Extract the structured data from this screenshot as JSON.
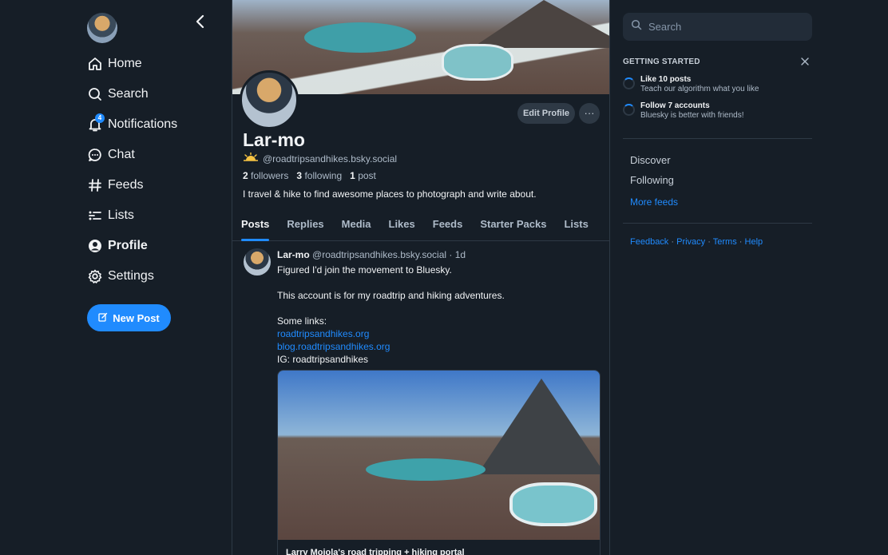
{
  "nav": {
    "items": [
      {
        "label": "Home",
        "icon": "home-icon"
      },
      {
        "label": "Search",
        "icon": "search-icon"
      },
      {
        "label": "Notifications",
        "icon": "bell-icon",
        "badge": "4"
      },
      {
        "label": "Chat",
        "icon": "chat-icon"
      },
      {
        "label": "Feeds",
        "icon": "hash-icon"
      },
      {
        "label": "Lists",
        "icon": "list-icon"
      },
      {
        "label": "Profile",
        "icon": "user-circle-icon",
        "active": true
      },
      {
        "label": "Settings",
        "icon": "gear-icon"
      }
    ],
    "new_post_label": "New Post"
  },
  "profile": {
    "display_name": "Lar-mo",
    "handle": "@roadtripsandhikes.bsky.social",
    "followers_count": "2",
    "followers_label": "followers",
    "following_count": "3",
    "following_label": "following",
    "posts_count": "1",
    "posts_label": "post",
    "bio": "I travel & hike to find awesome places to photograph and write about.",
    "edit_label": "Edit Profile",
    "more_label": "···"
  },
  "tabs": [
    "Posts",
    "Replies",
    "Media",
    "Likes",
    "Feeds",
    "Starter Packs",
    "Lists"
  ],
  "post": {
    "author": "Lar-mo",
    "handle": "@roadtripsandhikes.bsky.social",
    "time": "· 1d",
    "line1": "Figured I'd join the movement to Bluesky.",
    "line2": "This account is for my roadtrip and hiking adventures.",
    "line3": "Some links:",
    "link1": "roadtripsandhikes.org",
    "link2": "blog.roadtripsandhikes.org",
    "line4": "IG: roadtripsandhikes",
    "embed_title": "Larry Moiola's road tripping + hiking portal"
  },
  "right": {
    "search_placeholder": "Search",
    "getting_started_title": "GETTING STARTED",
    "tasks": [
      {
        "title": "Like 10 posts",
        "subtitle": "Teach our algorithm what you like"
      },
      {
        "title": "Follow 7 accounts",
        "subtitle": "Bluesky is better with friends!"
      }
    ],
    "feeds": [
      "Discover",
      "Following"
    ],
    "more_feeds": "More feeds",
    "footer": [
      "Feedback",
      "Privacy",
      "Terms",
      "Help"
    ],
    "footer_sep": "·"
  },
  "colors": {
    "background": "#161e27",
    "accent": "#208bfe",
    "border": "#2e3945",
    "muted_text": "#aebbc9"
  }
}
